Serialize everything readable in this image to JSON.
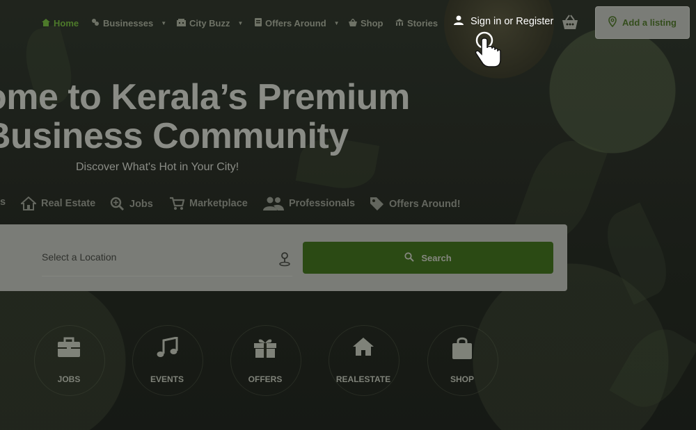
{
  "nav": {
    "items": [
      {
        "label": "Home",
        "icon": "home-icon",
        "active": true
      },
      {
        "label": "Businesses",
        "icon": "businesses-icon",
        "dropdown": true
      },
      {
        "label": "City Buzz",
        "icon": "city-buzz-icon",
        "dropdown": true
      },
      {
        "label": "Offers Around",
        "icon": "offers-icon",
        "dropdown": true
      },
      {
        "label": "Shop",
        "icon": "shop-icon"
      },
      {
        "label": "Stories",
        "icon": "stories-icon"
      }
    ],
    "signin_label": "Sign in or Register",
    "add_listing_label": "Add a listing"
  },
  "hero": {
    "title_line1": "ome to Kerala’s Premium",
    "title_line2": "Business Community",
    "subtitle": "Discover What's Hot in Your City!"
  },
  "categories": [
    {
      "label": "s"
    },
    {
      "label": "Real Estate",
      "icon": "real-estate-icon"
    },
    {
      "label": "Jobs",
      "icon": "jobs-search-icon"
    },
    {
      "label": "Marketplace",
      "icon": "cart-icon"
    },
    {
      "label": "Professionals",
      "icon": "people-icon"
    },
    {
      "label": "Offers Around!",
      "icon": "tag-icon"
    }
  ],
  "search": {
    "location_placeholder": "Select a Location",
    "button_label": "Search"
  },
  "tiles": [
    {
      "label": "JOBS",
      "icon": "briefcase-icon"
    },
    {
      "label": "EVENTS",
      "icon": "music-note-icon"
    },
    {
      "label": "OFFERS",
      "icon": "gift-icon"
    },
    {
      "label": "REALESTATE",
      "icon": "house-icon"
    },
    {
      "label": "SHOP",
      "icon": "shopping-bag-icon"
    }
  ],
  "colors": {
    "accent_green": "#4d7a2a",
    "search_button": "#2b4a14",
    "overlay": "#1c1f1a"
  }
}
